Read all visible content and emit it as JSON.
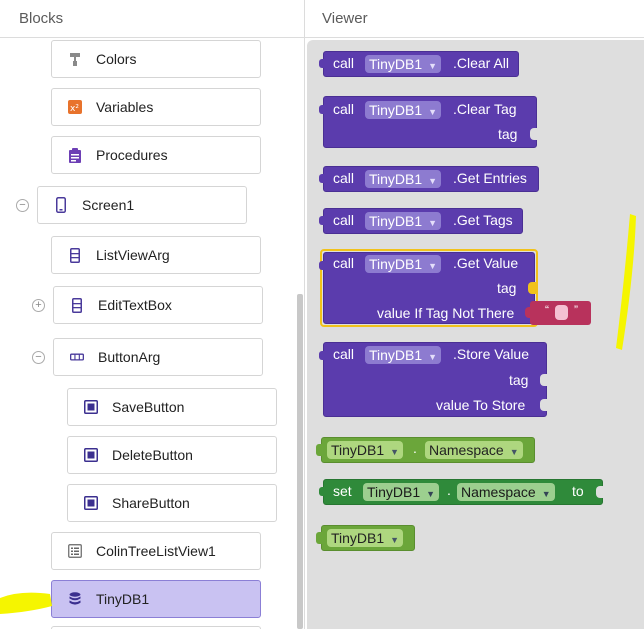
{
  "blocks_panel": {
    "title": "Blocks",
    "items": [
      {
        "label": "Colors",
        "icon": "paint-roller-icon"
      },
      {
        "label": "Variables",
        "icon": "variables-icon"
      },
      {
        "label": "Procedures",
        "icon": "procedures-icon"
      },
      {
        "label": "Screen1",
        "icon": "phone-icon",
        "toggle": "−"
      },
      {
        "label": "ListViewArg",
        "icon": "listview-icon"
      },
      {
        "label": "EditTextBox",
        "icon": "textbox-icon",
        "toggle": "+"
      },
      {
        "label": "ButtonArg",
        "icon": "horizontal-arrangement-icon",
        "toggle": "−"
      },
      {
        "label": "SaveButton",
        "icon": "button-icon"
      },
      {
        "label": "DeleteButton",
        "icon": "button-icon"
      },
      {
        "label": "ShareButton",
        "icon": "button-icon"
      },
      {
        "label": "ColinTreeListView1",
        "icon": "list-icon"
      },
      {
        "label": "TinyDB1",
        "icon": "database-icon",
        "selected": true
      }
    ]
  },
  "viewer": {
    "title": "Viewer",
    "component": "TinyDB1",
    "blocks": {
      "clear_all": {
        "call": "call",
        "method": ".Clear All"
      },
      "clear_tag": {
        "call": "call",
        "method": ".Clear Tag",
        "arg1": "tag"
      },
      "get_entries": {
        "call": "call",
        "method": ".Get Entries"
      },
      "get_tags": {
        "call": "call",
        "method": ".Get Tags"
      },
      "get_value": {
        "call": "call",
        "method": ".Get Value",
        "arg1": "tag",
        "arg2": "value If Tag Not There",
        "string_open": "“",
        "string_close": "”"
      },
      "store_value": {
        "call": "call",
        "method": ".Store Value",
        "arg1": "tag",
        "arg2": "value To Store"
      },
      "namespace_getter": {
        "dot": ".",
        "property": "Namespace"
      },
      "namespace_setter": {
        "set": "set",
        "dot": ".",
        "property": "Namespace",
        "to": "to"
      },
      "component_block": {}
    }
  },
  "colors": {
    "procedure_purple": "#5b3cad",
    "getter_green": "#6ba63a",
    "setter_green": "#2f8a3a",
    "selected_bg": "#c9c2f2",
    "highlight_yellow": "#f1c21b",
    "string_red": "#b8325c"
  }
}
